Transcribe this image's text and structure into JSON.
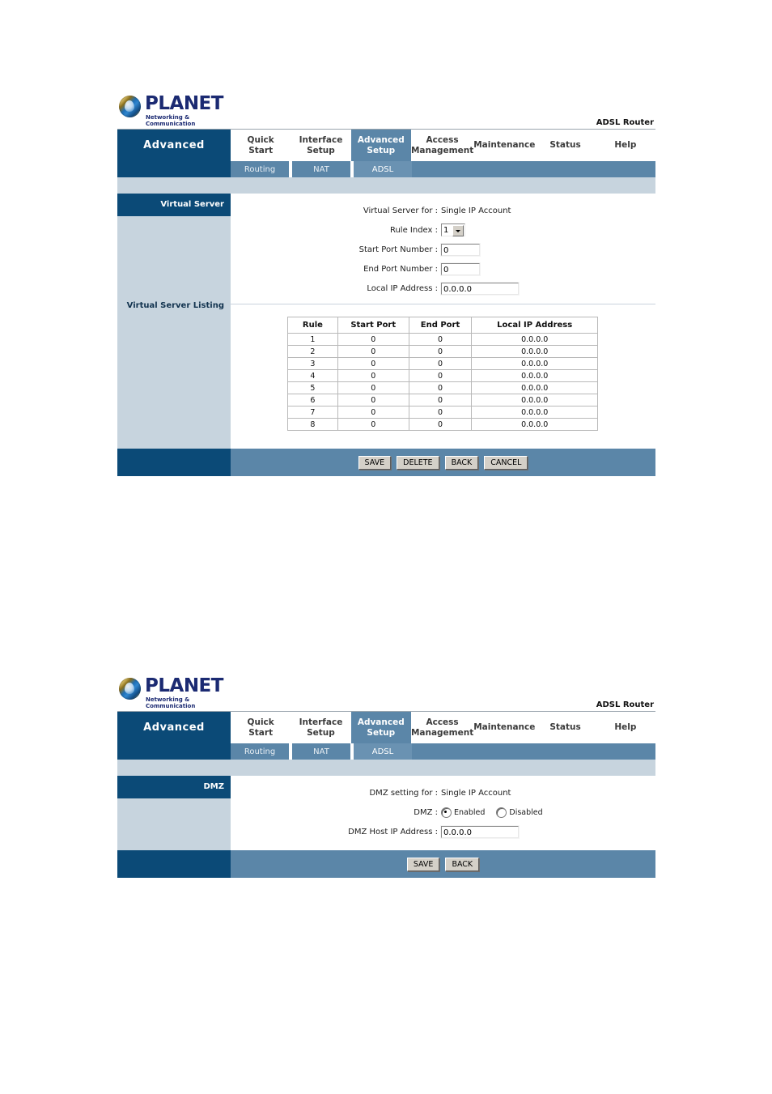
{
  "brand": {
    "logo_word": "PLANET",
    "logo_tagline": "Networking & Communication",
    "device_name": "ADSL Router",
    "logo_icon": "globe-icon"
  },
  "nav": {
    "section_label": "Advanced",
    "tabs": [
      {
        "label_top": "Quick",
        "label_bottom": "Start",
        "active": false
      },
      {
        "label_top": "Interface",
        "label_bottom": "Setup",
        "active": false
      },
      {
        "label_top": "Advanced",
        "label_bottom": "Setup",
        "active": true
      },
      {
        "label_top": "Access",
        "label_bottom": "Management",
        "active": false
      },
      {
        "label_top": "Maintenance",
        "label_bottom": "",
        "active": false
      },
      {
        "label_top": "Status",
        "label_bottom": "",
        "active": false
      },
      {
        "label_top": "Help",
        "label_bottom": "",
        "active": false
      }
    ],
    "subtabs": [
      {
        "label": "Routing",
        "active": false
      },
      {
        "label": "NAT",
        "active": false
      },
      {
        "label": "ADSL",
        "active": true
      }
    ]
  },
  "panel1": {
    "side_title": "Virtual Server",
    "side_subtitle": "Virtual Server Listing",
    "form": {
      "virtual_server_for_label": "Virtual Server for :",
      "virtual_server_for_value": "Single IP Account",
      "rule_index_label": "Rule Index :",
      "rule_index_value": "1",
      "start_port_label": "Start Port Number :",
      "start_port_value": "0",
      "end_port_label": "End Port Number :",
      "end_port_value": "0",
      "local_ip_label": "Local IP Address :",
      "local_ip_value": "0.0.0.0"
    },
    "table": {
      "headers": [
        "Rule",
        "Start Port",
        "End Port",
        "Local IP Address"
      ],
      "rows": [
        [
          "1",
          "0",
          "0",
          "0.0.0.0"
        ],
        [
          "2",
          "0",
          "0",
          "0.0.0.0"
        ],
        [
          "3",
          "0",
          "0",
          "0.0.0.0"
        ],
        [
          "4",
          "0",
          "0",
          "0.0.0.0"
        ],
        [
          "5",
          "0",
          "0",
          "0.0.0.0"
        ],
        [
          "6",
          "0",
          "0",
          "0.0.0.0"
        ],
        [
          "7",
          "0",
          "0",
          "0.0.0.0"
        ],
        [
          "8",
          "0",
          "0",
          "0.0.0.0"
        ]
      ]
    },
    "buttons": [
      "SAVE",
      "DELETE",
      "BACK",
      "CANCEL"
    ]
  },
  "panel2": {
    "side_title": "DMZ",
    "form": {
      "dmz_setting_for_label": "DMZ setting for :",
      "dmz_setting_for_value": "Single IP Account",
      "dmz_label": "DMZ :",
      "option_enabled": "Enabled",
      "option_disabled": "Disabled",
      "selected_option": "Enabled",
      "dmz_host_ip_label": "DMZ Host IP Address :",
      "dmz_host_ip_value": "0.0.0.0"
    },
    "buttons": [
      "SAVE",
      "BACK"
    ]
  },
  "colors": {
    "navy": "#0b4a77",
    "steel": "#5b86a8",
    "pale": "#c7d4de",
    "logo_blue": "#1b2a72"
  }
}
